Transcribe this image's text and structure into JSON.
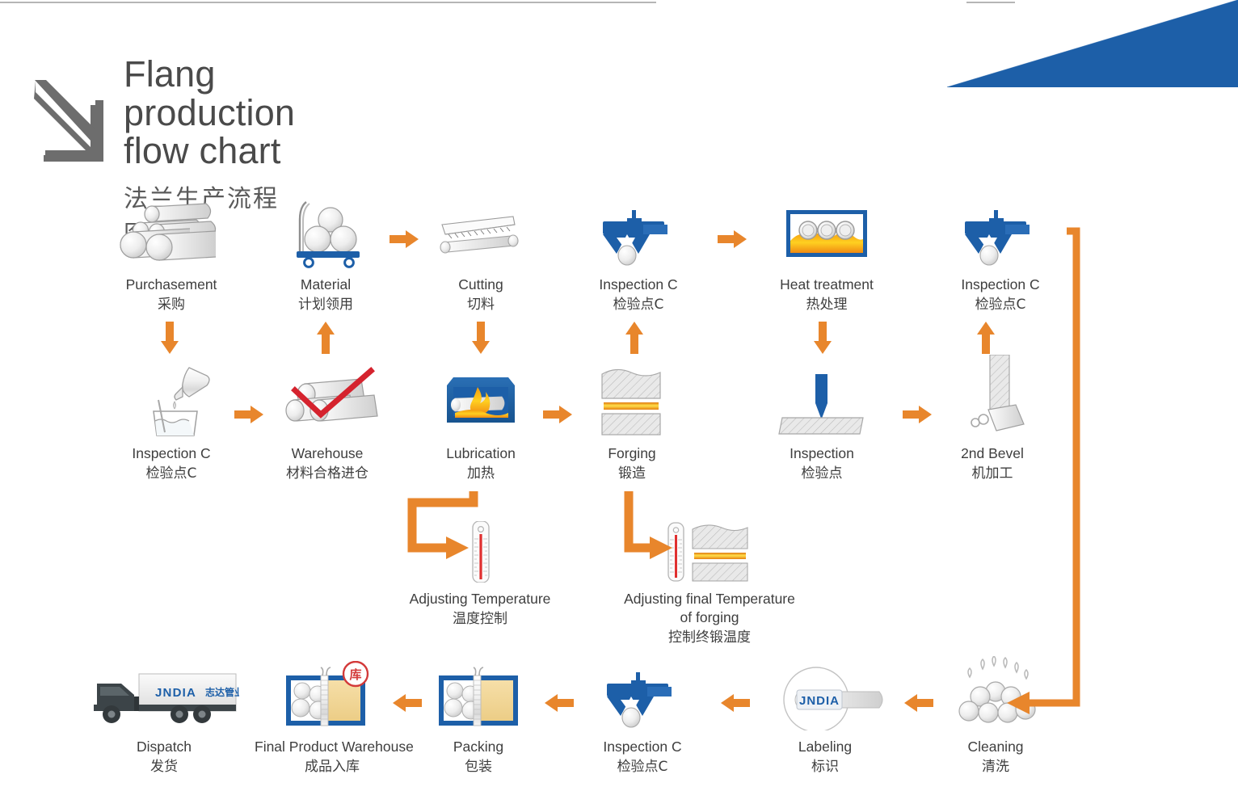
{
  "header": {
    "title_en": "Flang production flow chart",
    "title_cn": "法兰生产流程图",
    "arrow_icon": "down-right-arrow-icon"
  },
  "brand": {
    "name": "JNDIA",
    "name_cn": "志达管业",
    "stamp_cn": "库",
    "accent_blue": "#1d5fa8",
    "accent_orange": "#e8862c",
    "text_gray": "#3e3e3e"
  },
  "nodes": {
    "purchasement": {
      "en": "Purchasement",
      "cn": "采购",
      "icon": "steel-bars-icon"
    },
    "material": {
      "en": "Material",
      "cn": "计划领用",
      "icon": "material-cart-icon"
    },
    "cutting": {
      "en": "Cutting",
      "cn": "切料",
      "icon": "saw-cutting-icon"
    },
    "inspection_c_1": {
      "en": "Inspection C",
      "cn": "检验点C",
      "icon": "caliper-icon"
    },
    "heat_treatment": {
      "en": "Heat treatment",
      "cn": "热处理",
      "icon": "furnace-icon"
    },
    "inspection_c_2": {
      "en": "Inspection C",
      "cn": "检验点C",
      "icon": "caliper-icon"
    },
    "inspection_c_3": {
      "en": "Inspection C",
      "cn": "检验点C",
      "icon": "beaker-test-icon"
    },
    "warehouse": {
      "en": "Warehouse",
      "cn": "材料合格进仓",
      "icon": "bars-check-icon"
    },
    "lubrication": {
      "en": "Lubrication",
      "cn": "加热",
      "icon": "heating-furnace-icon"
    },
    "forging": {
      "en": "Forging",
      "cn": "锻造",
      "icon": "forging-press-icon"
    },
    "inspection": {
      "en": "Inspection",
      "cn": "检验点",
      "icon": "probe-plate-icon"
    },
    "second_bevel": {
      "en": "2nd Bevel",
      "cn": "机加工",
      "icon": "machining-tool-icon"
    },
    "adjust_temp": {
      "en": "Adjusting Temperature",
      "cn": "温度控制",
      "icon": "thermometer-icon"
    },
    "adjust_final_temp": {
      "en": "Adjusting final Temperature of forging",
      "cn": "控制终锻温度",
      "icon": "thermometer-press-icon"
    },
    "dispatch": {
      "en": "Dispatch",
      "cn": "发货",
      "icon": "truck-icon"
    },
    "final_warehouse": {
      "en": "Final Product Warehouse",
      "cn": "成品入库",
      "icon": "product-crate-icon"
    },
    "packing": {
      "en": "Packing",
      "cn": "包装",
      "icon": "packing-crate-icon"
    },
    "inspection_c_4": {
      "en": "Inspection C",
      "cn": "检验点C",
      "icon": "caliper-icon"
    },
    "labeling": {
      "en": "Labeling",
      "cn": "标识",
      "icon": "label-magnifier-icon"
    },
    "cleaning": {
      "en": "Cleaning",
      "cn": "清洗",
      "icon": "cleaning-drops-icon"
    }
  },
  "chart_data": {
    "type": "diagram",
    "title": "Flang production flow chart / 法兰生产流程图",
    "diagram_kind": "serpentine process flowchart",
    "rows": 3,
    "columns": 6,
    "steps": [
      {
        "order": 1,
        "en": "Purchasement",
        "cn": "采购",
        "row": 1,
        "col": 1
      },
      {
        "order": 2,
        "en": "Inspection C",
        "cn": "检验点C",
        "row": 2,
        "col": 1
      },
      {
        "order": 3,
        "en": "Warehouse",
        "cn": "材料合格进仓",
        "row": 2,
        "col": 2
      },
      {
        "order": 4,
        "en": "Material",
        "cn": "计划领用",
        "row": 1,
        "col": 2
      },
      {
        "order": 5,
        "en": "Cutting",
        "cn": "切料",
        "row": 1,
        "col": 3
      },
      {
        "order": 6,
        "en": "Lubrication",
        "cn": "加热",
        "row": 2,
        "col": 3
      },
      {
        "order": 7,
        "en": "Forging",
        "cn": "锻造",
        "row": 2,
        "col": 4
      },
      {
        "order": 8,
        "en": "Inspection C",
        "cn": "检验点C",
        "row": 1,
        "col": 4
      },
      {
        "order": 9,
        "en": "Heat treatment",
        "cn": "热处理",
        "row": 1,
        "col": 5
      },
      {
        "order": 10,
        "en": "Inspection",
        "cn": "检验点",
        "row": 2,
        "col": 5
      },
      {
        "order": 11,
        "en": "2nd Bevel",
        "cn": "机加工",
        "row": 2,
        "col": 6
      },
      {
        "order": 12,
        "en": "Inspection C",
        "cn": "检验点C",
        "row": 1,
        "col": 6
      },
      {
        "order": 13,
        "en": "Cleaning",
        "cn": "清洗",
        "row": 3,
        "col": 6
      },
      {
        "order": 14,
        "en": "Labeling",
        "cn": "标识",
        "row": 3,
        "col": 5
      },
      {
        "order": 15,
        "en": "Inspection C",
        "cn": "检验点C",
        "row": 3,
        "col": 4
      },
      {
        "order": 16,
        "en": "Packing",
        "cn": "包装",
        "row": 3,
        "col": 3
      },
      {
        "order": 17,
        "en": "Final Product Warehouse",
        "cn": "成品入库",
        "row": 3,
        "col": 2
      },
      {
        "order": 18,
        "en": "Dispatch",
        "cn": "发货",
        "row": 3,
        "col": 1
      }
    ],
    "branches": [
      {
        "from": "Lubrication",
        "to": "Adjusting Temperature",
        "to_cn": "温度控制"
      },
      {
        "from": "Forging",
        "to": "Adjusting final Temperature of forging",
        "to_cn": "控制终锻温度"
      }
    ]
  }
}
